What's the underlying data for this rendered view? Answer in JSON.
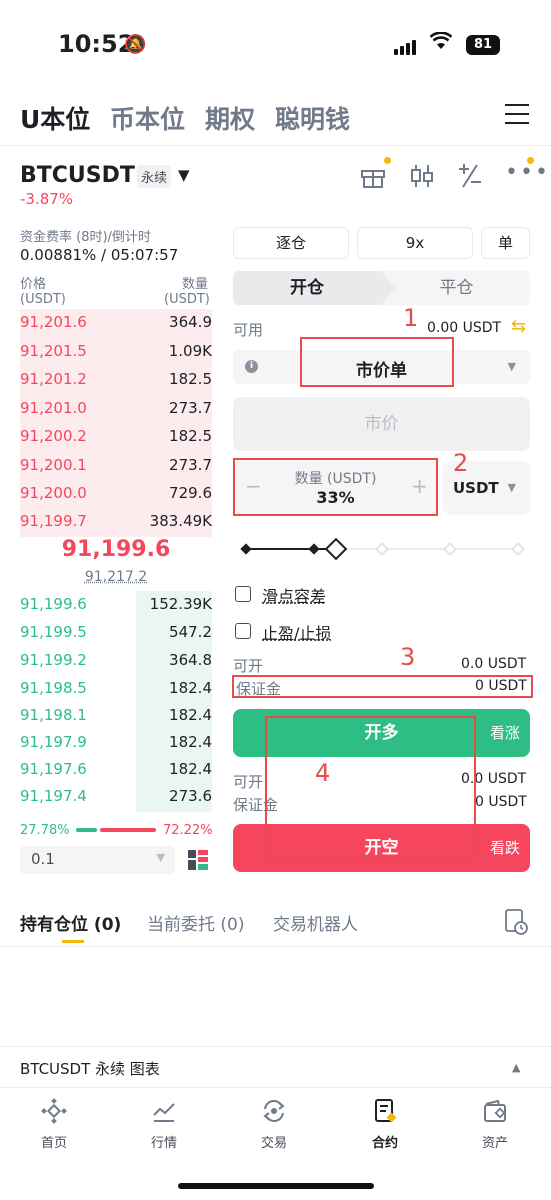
{
  "status_bar": {
    "time": "10:52",
    "battery": "81"
  },
  "top_tabs": [
    "U本位",
    "币本位",
    "期权",
    "聪明钱"
  ],
  "symbol": {
    "name": "BTCUSDT",
    "type": "永续",
    "change": "-3.87%"
  },
  "funding": {
    "label": "资金费率 (8时)/倒计时",
    "value": "0.00881% / 05:07:57"
  },
  "orderbook": {
    "price_label": "价格",
    "price_unit": "(USDT)",
    "qty_label": "数量",
    "qty_unit": "(USDT)",
    "asks": [
      {
        "price": "91,201.6",
        "qty": "364.9"
      },
      {
        "price": "91,201.5",
        "qty": "1.09K"
      },
      {
        "price": "91,201.2",
        "qty": "182.5"
      },
      {
        "price": "91,201.0",
        "qty": "273.7"
      },
      {
        "price": "91,200.2",
        "qty": "182.5"
      },
      {
        "price": "91,200.1",
        "qty": "273.7"
      },
      {
        "price": "91,200.0",
        "qty": "729.6"
      },
      {
        "price": "91,199.7",
        "qty": "383.49K"
      }
    ],
    "last_price": "91,199.6",
    "mark_price": "91,217.2",
    "bids": [
      {
        "price": "91,199.6",
        "qty": "152.39K"
      },
      {
        "price": "91,199.5",
        "qty": "547.2"
      },
      {
        "price": "91,199.2",
        "qty": "364.8"
      },
      {
        "price": "91,198.5",
        "qty": "182.4"
      },
      {
        "price": "91,198.1",
        "qty": "182.4"
      },
      {
        "price": "91,197.9",
        "qty": "182.4"
      },
      {
        "price": "91,197.6",
        "qty": "182.4"
      },
      {
        "price": "91,197.4",
        "qty": "273.6"
      }
    ],
    "buy_ratio": "27.78%",
    "sell_ratio": "72.22%",
    "depth": "0.1"
  },
  "trade": {
    "margin_mode": "逐仓",
    "leverage": "9x",
    "position_mode": "单",
    "open_tab": "开仓",
    "close_tab": "平仓",
    "available_label": "可用",
    "available_value": "0.00 USDT",
    "order_type": "市价单",
    "price_placeholder": "市价",
    "qty_label": "数量 (USDT)",
    "qty_value": "33%",
    "qty_unit": "USDT",
    "slippage_label": "滑点容差",
    "tpsl_label": "止盈/止损",
    "long_open_label": "可开",
    "long_open_value": "0.0 USDT",
    "long_margin_label": "保证金",
    "long_margin_value": "0 USDT",
    "long_button": "开多",
    "long_side": "看涨",
    "short_open_label": "可开",
    "short_open_value": "0.0 USDT",
    "short_margin_label": "保证金",
    "short_margin_value": "0 USDT",
    "short_button": "开空",
    "short_side": "看跌"
  },
  "annotations": [
    "1",
    "2",
    "3",
    "4"
  ],
  "position_tabs": [
    "持有仓位 (0)",
    "当前委托 (0)",
    "交易机器人"
  ],
  "chart_bar": {
    "label": "BTCUSDT 永续  图表"
  },
  "bottom_nav": [
    "首页",
    "行情",
    "交易",
    "合约",
    "资产"
  ]
}
